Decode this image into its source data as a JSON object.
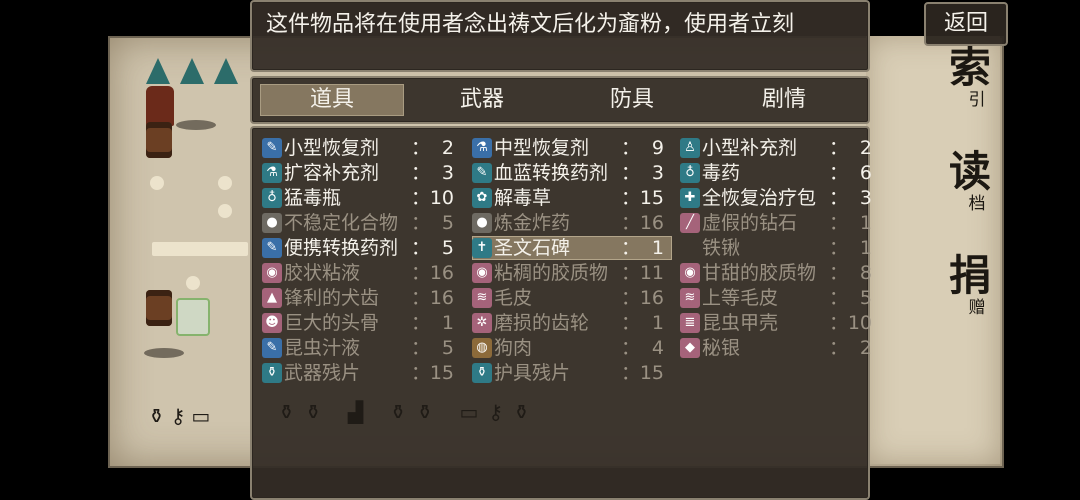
{
  "help_text": "这件物品将在使用者念出祷文后化为齑粉，使用者立刻",
  "back_label": "返回",
  "categories": [
    {
      "label": "道具",
      "selected": true
    },
    {
      "label": "武器",
      "selected": false
    },
    {
      "label": "防具",
      "selected": false
    },
    {
      "label": "剧情",
      "selected": false
    }
  ],
  "side_menu": [
    {
      "big": "索",
      "small": "引"
    },
    {
      "big": "读",
      "small": "档"
    },
    {
      "big": "捐",
      "small": "赠"
    }
  ],
  "items": [
    [
      {
        "name": "小型恢复剂",
        "count": "2",
        "icon": "potion-icon",
        "style": "blue",
        "dim": false
      },
      {
        "name": "扩容补充剂",
        "count": "3",
        "icon": "flask-icon",
        "style": "teal",
        "dim": false
      },
      {
        "name": "猛毒瓶",
        "count": "10",
        "icon": "poison-bottle-icon",
        "style": "teal",
        "dim": false
      },
      {
        "name": "不稳定化合物",
        "count": "5",
        "icon": "bomb-icon",
        "style": "gray",
        "dim": true
      },
      {
        "name": "便携转换药剂",
        "count": "5",
        "icon": "syringe-icon",
        "style": "blue",
        "dim": false
      },
      {
        "name": "胶状粘液",
        "count": "16",
        "icon": "slime-icon",
        "style": "pink",
        "dim": true
      },
      {
        "name": "锋利的犬齿",
        "count": "16",
        "icon": "fang-icon",
        "style": "pink",
        "dim": true
      },
      {
        "name": "巨大的头骨",
        "count": "1",
        "icon": "skull-icon",
        "style": "pink",
        "dim": true
      },
      {
        "name": "昆虫汁液",
        "count": "5",
        "icon": "syringe-icon",
        "style": "blue",
        "dim": true
      },
      {
        "name": "武器残片",
        "count": "15",
        "icon": "pouch-icon",
        "style": "teal",
        "dim": true
      }
    ],
    [
      {
        "name": "中型恢复剂",
        "count": "9",
        "icon": "flask-icon",
        "style": "blue",
        "dim": false
      },
      {
        "name": "血蓝转换药剂",
        "count": "3",
        "icon": "potion-icon",
        "style": "teal",
        "dim": false
      },
      {
        "name": "解毒草",
        "count": "15",
        "icon": "herb-icon",
        "style": "teal",
        "dim": false
      },
      {
        "name": "炼金炸药",
        "count": "16",
        "icon": "bomb-icon",
        "style": "gray",
        "dim": true
      },
      {
        "name": "圣文石碑",
        "count": "1",
        "icon": "cross-icon",
        "style": "teal",
        "dim": false,
        "selected": true
      },
      {
        "name": "粘稠的胶质物",
        "count": "11",
        "icon": "slime-icon",
        "style": "pink",
        "dim": true
      },
      {
        "name": "毛皮",
        "count": "16",
        "icon": "fur-icon",
        "style": "pink",
        "dim": true
      },
      {
        "name": "磨损的齿轮",
        "count": "1",
        "icon": "gear-icon",
        "style": "pink",
        "dim": true
      },
      {
        "name": "狗肉",
        "count": "4",
        "icon": "meat-icon",
        "style": "brown",
        "dim": true
      },
      {
        "name": "护具残片",
        "count": "15",
        "icon": "pouch-icon",
        "style": "teal",
        "dim": true
      }
    ],
    [
      {
        "name": "小型补充剂",
        "count": "2",
        "icon": "figure-icon",
        "style": "teal",
        "dim": false
      },
      {
        "name": "毒药",
        "count": "6",
        "icon": "poison-bottle-icon",
        "style": "teal",
        "dim": false
      },
      {
        "name": "全恢复治疗包",
        "count": "3",
        "icon": "medkit-icon",
        "style": "teal",
        "dim": false
      },
      {
        "name": "虚假的钻石",
        "count": "1",
        "icon": "wand-icon",
        "style": "pink",
        "dim": true
      },
      {
        "name": "铁锹",
        "count": "1",
        "icon": "",
        "style": "none",
        "dim": true
      },
      {
        "name": "甘甜的胶质物",
        "count": "8",
        "icon": "slime-icon",
        "style": "pink",
        "dim": true
      },
      {
        "name": "上等毛皮",
        "count": "5",
        "icon": "fur-icon",
        "style": "pink",
        "dim": true
      },
      {
        "name": "昆虫甲壳",
        "count": "10",
        "icon": "shell-icon",
        "style": "pink",
        "dim": true
      },
      {
        "name": "秘银",
        "count": "2",
        "icon": "ore-icon",
        "style": "pink",
        "dim": true
      }
    ]
  ]
}
